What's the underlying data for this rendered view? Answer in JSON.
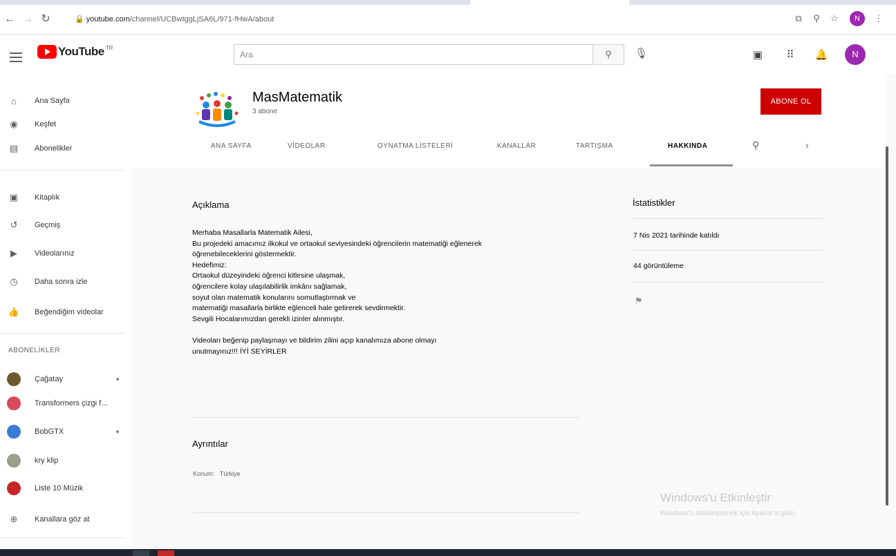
{
  "browser": {
    "url_host": "youtube.com",
    "url_path": "/channel/UCBwtggLjSA6L/971-fHwA/about",
    "profile_initial": "N"
  },
  "masthead": {
    "logo_text": "YouTube",
    "logo_country": "TR",
    "search_placeholder": "Ara",
    "avatar_initial": "N"
  },
  "sidebar": {
    "main": [
      {
        "label": "Ana Sayfa",
        "icon": "home-icon"
      },
      {
        "label": "Keşfet",
        "icon": "compass-icon"
      },
      {
        "label": "Abonelikler",
        "icon": "subscriptions-icon"
      }
    ],
    "library": [
      {
        "label": "Kitaplık",
        "icon": "library-icon"
      },
      {
        "label": "Geçmiş",
        "icon": "history-icon"
      },
      {
        "label": "Videolarınız",
        "icon": "your-videos-icon"
      },
      {
        "label": "Daha sonra izle",
        "icon": "watch-later-icon"
      },
      {
        "label": "Beğendiğim videolar",
        "icon": "like-icon"
      }
    ],
    "subscriptions_heading": "ABONELİKLER",
    "subscriptions": [
      {
        "label": "Çağatay",
        "color": "#6b5a2e",
        "dot": true
      },
      {
        "label": "Transformers çizgi f...",
        "color": "#d84a5c",
        "dot": false
      },
      {
        "label": "BobGTX",
        "color": "#3a7bd5",
        "dot": true
      },
      {
        "label": "kry klip",
        "color": "#9aa08a",
        "dot": false
      },
      {
        "label": "Liste 10 Müzik",
        "color": "#c62828",
        "dot": false
      }
    ],
    "browse_channels": "Kanallara göz at"
  },
  "channel": {
    "name": "MasMatematik",
    "subscribers": "3 abone",
    "subscribe_label": "ABONE OL",
    "tabs": [
      "ANA SAYFA",
      "VİDEOLAR",
      "OYNATMA LİSTELERİ",
      "KANALLAR",
      "TARTIŞMA",
      "HAKKINDA"
    ],
    "active_tab": "HAKKINDA"
  },
  "about": {
    "description_title": "Açıklama",
    "description_lines": [
      "Merhaba Masallarla Matematik Ailesi,",
      "Bu projedeki amacımız ilkokul ve ortaokul seviyesindeki öğrencilerin matematiği eğlenerek",
      "öğrenebileceklerini göstermektir.",
      "Hedefimiz:",
      "Ortaokul düzeyindeki öğrenci kitlesine ulaşmak,",
      "öğrencilere kolay ulaşılabilirlik imkânı sağlamak,",
      "soyut olan matematik konularını somutlaştırmak ve",
      "matematiği masallarla birlikte eğlenceli hale getirerek sevdirmektir.",
      "Sevgili Hocalarımızdan gerekli izinler alınmıştır.",
      "",
      "Videoları beğenip paylaşmayı ve bildirim zilini açıp kanalımıza abone olmayı",
      "unutmayınız!!! İYİ SEYİRLER"
    ],
    "details_title": "Ayrıntılar",
    "location_label": "Konum:",
    "location_value": "Türkiye",
    "stats_title": "İstatistikler",
    "joined": "7 Nis 2021 tarihinde katıldı",
    "views": "44 görüntüleme"
  },
  "watermark": {
    "line1": "Windows'u Etkinleştir",
    "line2": "Windows'u etkinleştirmek için Ayarlar'a gidin."
  }
}
